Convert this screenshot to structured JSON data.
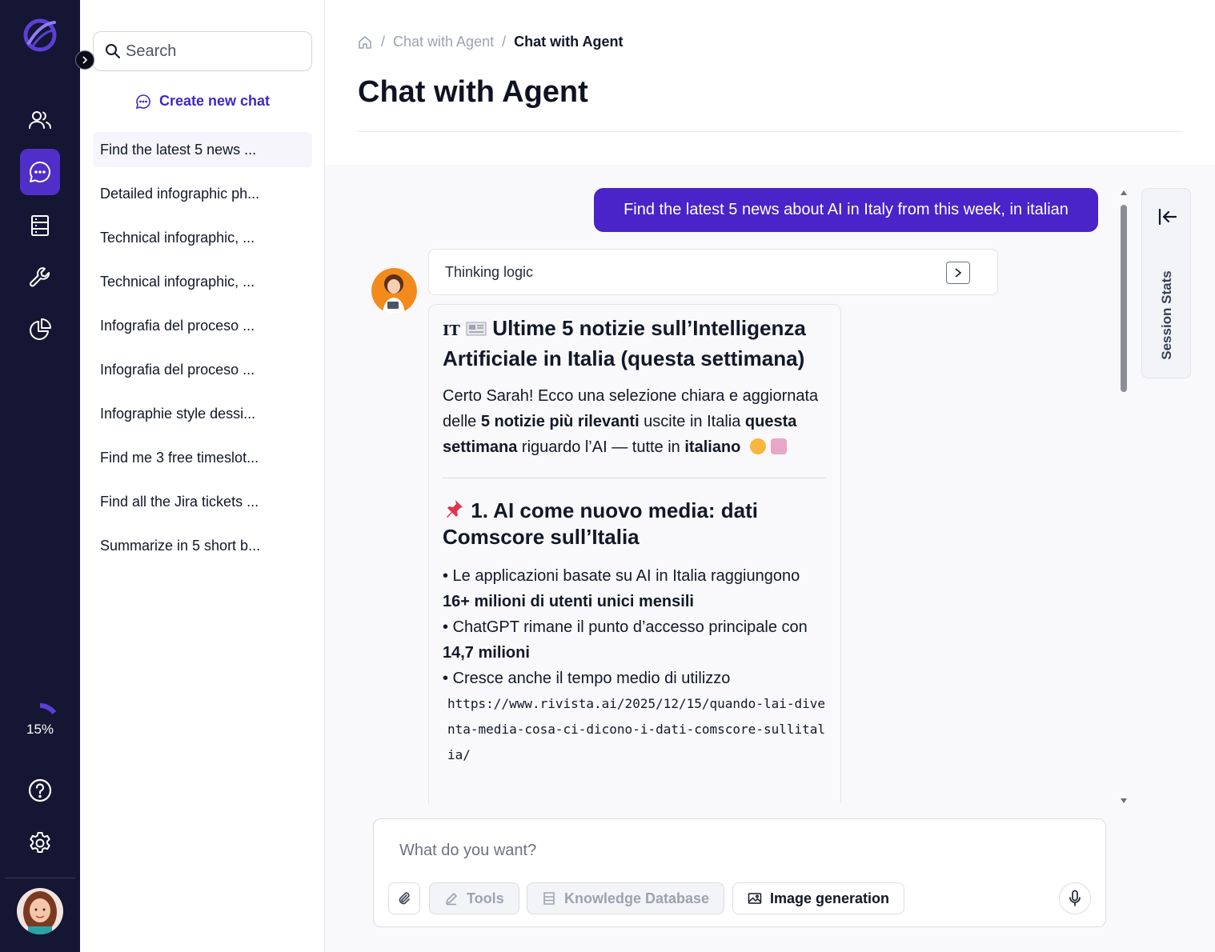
{
  "sidebar": {
    "usage_percent": 15,
    "usage_label": "15%",
    "nav_icons": [
      "users-icon",
      "chat-icon",
      "database-icon",
      "wrench-icon",
      "pie-chart-icon"
    ],
    "bottom_icons": [
      "help-icon",
      "gear-icon"
    ],
    "accent": "#4f2fc7",
    "background": "#141633"
  },
  "chatlist": {
    "search_placeholder": "Search",
    "new_chat_label": "Create new chat",
    "items": [
      {
        "label": "Find the latest 5 news ..."
      },
      {
        "label": "Detailed infographic ph..."
      },
      {
        "label": "Technical infographic, ..."
      },
      {
        "label": "Technical infographic, ..."
      },
      {
        "label": "Infografia del proceso ..."
      },
      {
        "label": "Infografia del proceso ..."
      },
      {
        "label": "Infographie style dessi..."
      },
      {
        "label": "Find me 3 free timeslot..."
      },
      {
        "label": "Find all the Jira tickets ..."
      },
      {
        "label": "Summarize in 5 short b..."
      }
    ]
  },
  "header": {
    "breadcrumb": [
      "Chat with Agent",
      "Chat with Agent"
    ],
    "title": "Chat with Agent"
  },
  "conversation": {
    "user_message": "Find the latest 5 news about AI in Italy from this week, in italian",
    "thinking_label": "Thinking logic",
    "answer": {
      "title_flag": "IT",
      "title": "Ultime 5 notizie sull’Intelligenza Artificiale in Italia (questa settimana)",
      "intro_1": "Certo Sarah! Ecco una selezione chiara e aggiornata delle ",
      "intro_bold_1": "5 notizie più rilevanti",
      "intro_2": " uscite in Italia ",
      "intro_bold_2": "questa settimana",
      "intro_3": " riguardo l’AI — tutte in ",
      "intro_bold_3": "italiano",
      "section_1_title": "1. AI come nuovo media: dati Comscore sull’Italia",
      "bullet_1_text": "• Le applicazioni basate su AI in Italia raggiungono ",
      "bullet_1_bold": "16+ milioni di utenti unici mensili",
      "bullet_2_text": "• ChatGPT rimane il punto d’accesso principale con ",
      "bullet_2_bold": "14,7 milioni",
      "bullet_3_text": "• Cresce anche il tempo medio di utilizzo",
      "link": "https://www.rivista.ai/2025/12/15/quando-lai-diventa-media-cosa-ci-dicono-i-dati-comscore-sullitalia/"
    }
  },
  "stats_panel": {
    "label": "Session Stats"
  },
  "composer": {
    "placeholder": "What do you want?",
    "tools_label": "Tools",
    "knowledge_label": "Knowledge Database",
    "image_label": "Image generation"
  }
}
